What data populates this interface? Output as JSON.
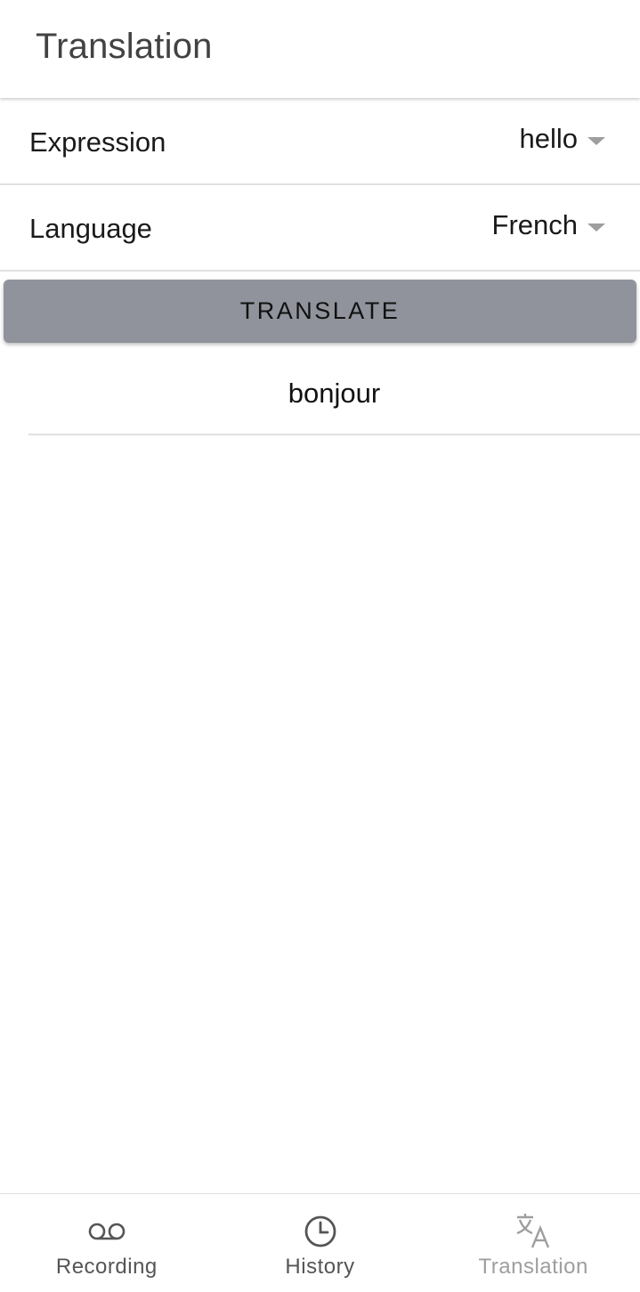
{
  "header": {
    "title": "Translation"
  },
  "form": {
    "expression": {
      "label": "Expression",
      "value": "hello"
    },
    "language": {
      "label": "Language",
      "value": "French"
    }
  },
  "translate_button": {
    "label": "TRANSLATE"
  },
  "result": {
    "text": "bonjour"
  },
  "bottom_nav": {
    "items": [
      {
        "label": "Recording",
        "icon": "voicemail-icon",
        "active": false
      },
      {
        "label": "History",
        "icon": "clock-icon",
        "active": false
      },
      {
        "label": "Translation",
        "icon": "translate-icon",
        "active": true
      }
    ]
  },
  "colors": {
    "button_bg": "#90939b",
    "divider": "#e0e0e0",
    "active_nav": "#9e9e9e",
    "inactive_nav": "#555555"
  }
}
